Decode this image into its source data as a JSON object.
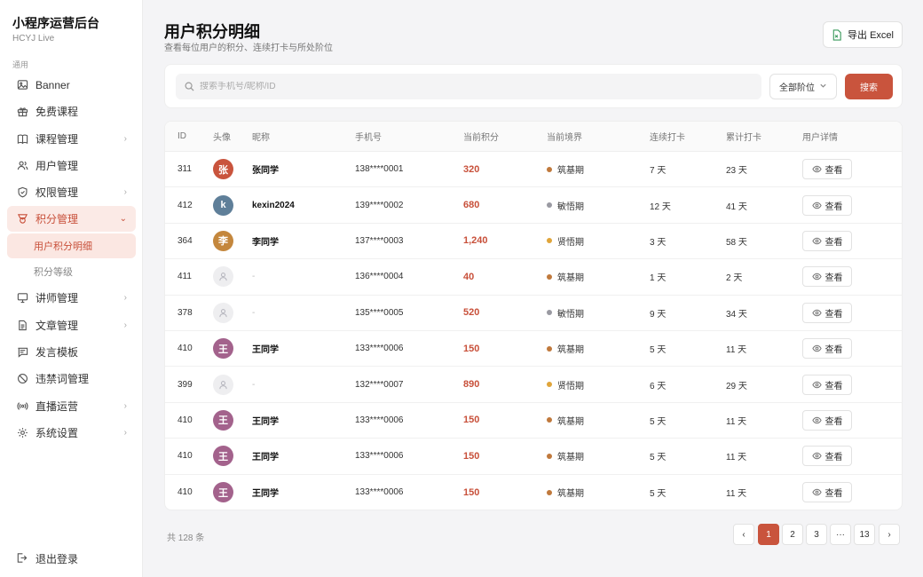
{
  "brand": {
    "title": "小程序运营后台",
    "subtitle": "HCYJ Live"
  },
  "sidebar": {
    "section_label": "通用",
    "items": [
      {
        "label": "Banner",
        "icon": "image-icon"
      },
      {
        "label": "免费课程",
        "icon": "gift-icon"
      },
      {
        "label": "课程管理",
        "icon": "book-icon",
        "has_children": true
      },
      {
        "label": "用户管理",
        "icon": "users-icon"
      },
      {
        "label": "权限管理",
        "icon": "shield-icon",
        "has_children": true
      },
      {
        "label": "积分管理",
        "icon": "trophy-icon",
        "expanded": true
      },
      {
        "label": "讲师管理",
        "icon": "monitor-icon",
        "has_children": true
      },
      {
        "label": "文章管理",
        "icon": "document-icon",
        "has_children": true
      },
      {
        "label": "发言模板",
        "icon": "message-icon"
      },
      {
        "label": "违禁词管理",
        "icon": "ban-icon"
      },
      {
        "label": "直播运营",
        "icon": "broadcast-icon",
        "has_children": true
      },
      {
        "label": "系统设置",
        "icon": "gear-icon",
        "has_children": true
      }
    ],
    "sub_items": [
      {
        "label": "用户积分明细",
        "active": true
      },
      {
        "label": "积分等级",
        "active": false
      }
    ],
    "logout_label": "退出登录"
  },
  "header": {
    "title": "用户积分明细",
    "subtitle": "查看每位用户的积分、连续打卡与所处阶位",
    "export_label": "导出 Excel"
  },
  "search": {
    "placeholder": "搜索手机号/昵称/ID",
    "value": "",
    "level_selected": "全部阶位",
    "button_label": "搜索"
  },
  "table": {
    "columns": [
      "ID",
      "头像",
      "昵称",
      "手机号",
      "当前积分",
      "当前境界",
      "连续打卡",
      "累计打卡",
      "用户详情"
    ],
    "view_label": "查看",
    "rows": [
      {
        "id": "311",
        "avatar": "张",
        "avatar_color": "#c9543d",
        "nickname": "张同学",
        "phone": "138****0001",
        "points": "320",
        "realm": "筑基期",
        "realm_color": "#c0793c",
        "streak": "7 天",
        "total": "23 天"
      },
      {
        "id": "412",
        "avatar": "k",
        "avatar_color": "#5f7f99",
        "nickname": "kexin2024",
        "phone": "139****0002",
        "points": "680",
        "realm": "敏悟期",
        "realm_color": "#9a9aa2",
        "streak": "12 天",
        "total": "41 天"
      },
      {
        "id": "364",
        "avatar": "李",
        "avatar_color": "#c4873d",
        "nickname": "李同学",
        "phone": "137****0003",
        "points": "1,240",
        "realm": "贤悟期",
        "realm_color": "#e0a53a",
        "streak": "3 天",
        "total": "58 天"
      },
      {
        "id": "411",
        "avatar": "",
        "avatar_color": "",
        "nickname": "-",
        "phone": "136****0004",
        "points": "40",
        "realm": "筑基期",
        "realm_color": "#c0793c",
        "streak": "1 天",
        "total": "2 天"
      },
      {
        "id": "378",
        "avatar": "",
        "avatar_color": "",
        "nickname": "-",
        "phone": "135****0005",
        "points": "520",
        "realm": "敏悟期",
        "realm_color": "#9a9aa2",
        "streak": "9 天",
        "total": "34 天"
      },
      {
        "id": "410",
        "avatar": "王",
        "avatar_color": "#a3628c",
        "nickname": "王同学",
        "phone": "133****0006",
        "points": "150",
        "realm": "筑基期",
        "realm_color": "#c0793c",
        "streak": "5 天",
        "total": "11 天"
      },
      {
        "id": "399",
        "avatar": "",
        "avatar_color": "",
        "nickname": "-",
        "phone": "132****0007",
        "points": "890",
        "realm": "贤悟期",
        "realm_color": "#e0a53a",
        "streak": "6 天",
        "total": "29 天"
      },
      {
        "id": "410",
        "avatar": "王",
        "avatar_color": "#a3628c",
        "nickname": "王同学",
        "phone": "133****0006",
        "points": "150",
        "realm": "筑基期",
        "realm_color": "#c0793c",
        "streak": "5 天",
        "total": "11 天"
      },
      {
        "id": "410",
        "avatar": "王",
        "avatar_color": "#a3628c",
        "nickname": "王同学",
        "phone": "133****0006",
        "points": "150",
        "realm": "筑基期",
        "realm_color": "#c0793c",
        "streak": "5 天",
        "total": "11 天"
      },
      {
        "id": "410",
        "avatar": "王",
        "avatar_color": "#a3628c",
        "nickname": "王同学",
        "phone": "133****0006",
        "points": "150",
        "realm": "筑基期",
        "realm_color": "#c0793c",
        "streak": "5 天",
        "total": "11 天"
      }
    ]
  },
  "footer": {
    "total_text": "共 128 条",
    "pages": [
      "‹",
      "1",
      "2",
      "3",
      "···",
      "13",
      "›"
    ],
    "current_page": "1"
  },
  "colors": {
    "accent": "#c9543d",
    "accent_bg": "#fbeae6"
  }
}
